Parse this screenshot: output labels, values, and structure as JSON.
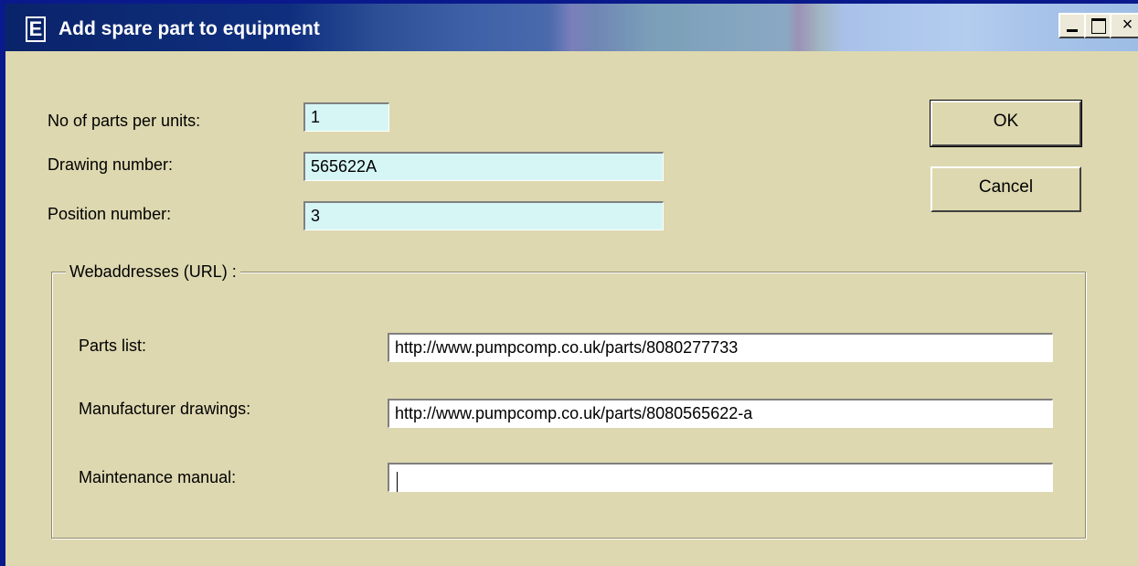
{
  "window": {
    "title": "Add spare part to equipment",
    "app_icon_letter": "E",
    "controls": {
      "minimize": "minimize-icon",
      "maximize": "maximize-icon",
      "close": "close-icon",
      "close_glyph": "×"
    }
  },
  "form": {
    "parts_per_unit": {
      "label": "No of parts per units:",
      "value": "1"
    },
    "drawing_number": {
      "label": "Drawing number:",
      "value": "565622A"
    },
    "position_number": {
      "label": "Position number:",
      "value": "3"
    }
  },
  "buttons": {
    "ok": "OK",
    "cancel": "Cancel"
  },
  "web": {
    "group_label": "Webaddresses (URL) :",
    "parts_list": {
      "label": "Parts list:",
      "value": "http://www.pumpcomp.co.uk/parts/8080277733"
    },
    "manufacturer_drawings": {
      "label": "Manufacturer drawings:",
      "value": "http://www.pumpcomp.co.uk/parts/8080565622-a"
    },
    "maintenance_manual": {
      "label": "Maintenance manual:",
      "value": ""
    }
  },
  "colors": {
    "dialog_bg": "#ddd8b0",
    "field_bg": "#d6f6f6",
    "titlebar_start": "#0a246a",
    "window_frame": "#0a1a8c"
  }
}
